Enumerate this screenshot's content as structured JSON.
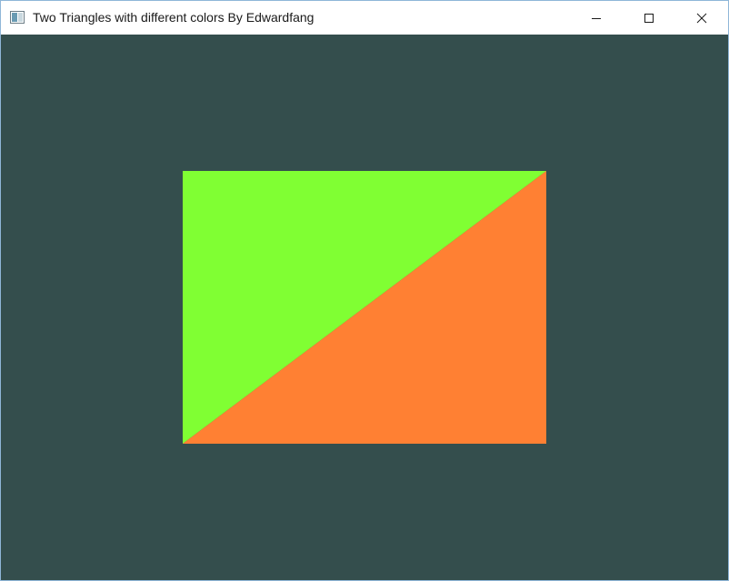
{
  "window": {
    "title": "Two Triangles with different colors By Edwardfang"
  },
  "controls": {
    "minimize_icon": "minimize-icon",
    "maximize_icon": "maximize-icon",
    "close_icon": "close-icon"
  },
  "scene": {
    "clear_color": "#344e4d",
    "triangles": [
      {
        "name": "top-left-triangle",
        "color": "#80ff33"
      },
      {
        "name": "bottom-right-triangle",
        "color": "#ff8033"
      }
    ]
  }
}
